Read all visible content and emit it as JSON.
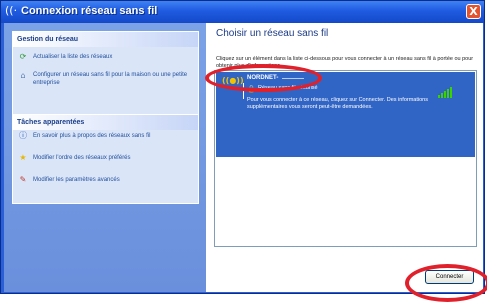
{
  "window": {
    "title": "Connexion réseau sans fil",
    "close_glyph": "X"
  },
  "left": {
    "network_tasks": {
      "header": "Gestion du réseau",
      "items": [
        {
          "icon": "refresh-icon",
          "label": "Actualiser la liste des réseaux"
        },
        {
          "icon": "setup-wireless-icon",
          "label": "Configurer un réseau sans fil pour la maison ou une petite entreprise"
        }
      ]
    },
    "related_tasks": {
      "header": "Tâches apparentées",
      "items": [
        {
          "icon": "info-icon",
          "label": "En savoir plus à propos des réseaux sans fil"
        },
        {
          "icon": "star-icon",
          "label": "Modifier l'ordre des réseaux préférés"
        },
        {
          "icon": "settings-icon",
          "label": "Modifier les paramètres avancés"
        }
      ]
    }
  },
  "right": {
    "title": "Choisir un réseau sans fil",
    "description": "Cliquez sur un élément dans la liste ci-dessous pour vous connecter à un réseau sans fil à portée ou pour obtenir plus d'informations.",
    "network": {
      "name": "NORDNET-",
      "icon_text": "((●))",
      "security": "Réseau sans fil sécurisé",
      "signal_bars": 5,
      "details": "Pour vous connecter à ce réseau, cliquez sur Connecter. Des informations supplémentaires vous seront peut-être demandées."
    },
    "connect_label": "Connecter"
  },
  "colors": {
    "annotation": "#e0202a",
    "selection": "#3165c5",
    "titlebar": "#1f5be0"
  }
}
